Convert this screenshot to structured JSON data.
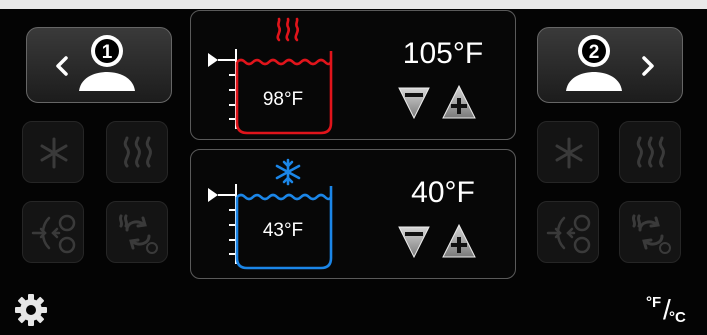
{
  "user1": {
    "number": "1"
  },
  "user2": {
    "number": "2"
  },
  "zone_hot": {
    "current_temp": "98°F",
    "set_temp": "105°F"
  },
  "zone_cold": {
    "current_temp": "43°F",
    "set_temp": "40°F"
  },
  "unit_toggle": {
    "fahrenheit": "°F",
    "slash": "/",
    "celsius": "°C"
  },
  "colors": {
    "hot": "#e0141b",
    "cold": "#1b86e8",
    "panel_border": "#5a5a5a",
    "background": "#040404"
  },
  "icons": [
    "chevron-left-icon",
    "user-icon",
    "chevron-right-icon",
    "snowflake-icon",
    "heat-waves-icon",
    "heat-exchange-icon",
    "cycle-icon",
    "minus-icon",
    "plus-icon",
    "gear-icon"
  ]
}
